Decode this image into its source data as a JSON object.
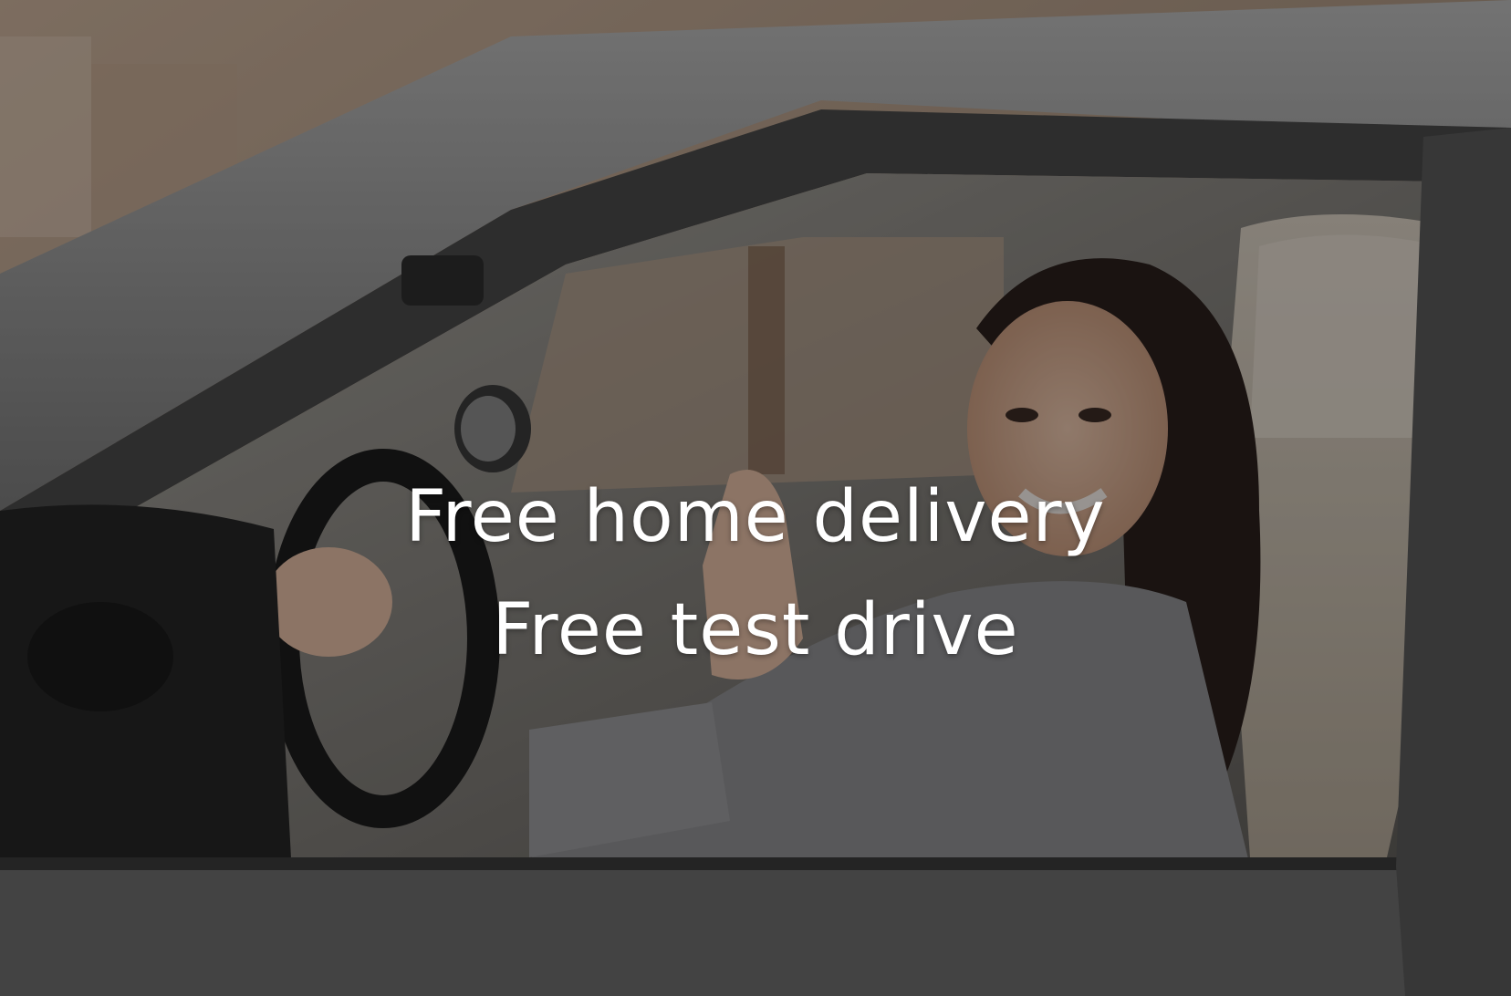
{
  "hero": {
    "image_alt": "",
    "overlay_color": "#000000",
    "caption": {
      "line1": "Free home delivery",
      "line2": "Free test drive"
    },
    "text_color": "#ffffff"
  }
}
